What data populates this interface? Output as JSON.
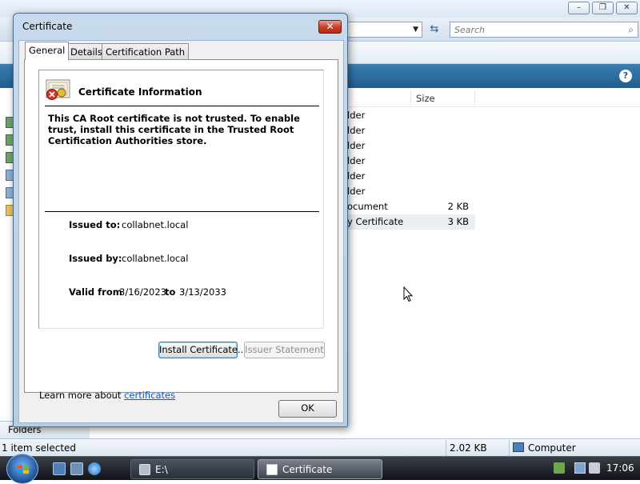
{
  "explorer": {
    "search_placeholder": "Search",
    "column_size": "Size",
    "files": [
      {
        "name": "lder",
        "size": ""
      },
      {
        "name": "lder",
        "size": ""
      },
      {
        "name": "lder",
        "size": ""
      },
      {
        "name": "lder",
        "size": ""
      },
      {
        "name": "lder",
        "size": ""
      },
      {
        "name": "lder",
        "size": ""
      },
      {
        "name": "ocument",
        "size": "2 KB"
      },
      {
        "name": "y Certificate",
        "size": "3 KB"
      }
    ],
    "folders_label": "Folders",
    "status": {
      "selection": "1 item selected",
      "size": "2.02 KB",
      "location": "Computer"
    },
    "help_label": "?"
  },
  "taskbar": {
    "items": [
      {
        "label": "E:\\"
      },
      {
        "label": "Certificate"
      }
    ],
    "clock": "17:06"
  },
  "dialog": {
    "title": "Certificate",
    "close_label": "✕",
    "tabs": [
      {
        "label": "General",
        "active": true
      },
      {
        "label": "Details",
        "active": false
      },
      {
        "label": "Certification Path",
        "active": false
      }
    ],
    "heading": "Certificate Information",
    "warning": "This CA Root certificate is not trusted. To enable trust, install this certificate in the Trusted Root Certification Authorities store.",
    "issued_to_label": "Issued to:",
    "issued_to": "collabnet.local",
    "issued_by_label": "Issued by:",
    "issued_by": "collabnet.local",
    "valid_from_label": "Valid from",
    "valid_from": "3/16/2023",
    "valid_to_label": "to",
    "valid_to": "3/13/2033",
    "install_button": "Install Certificate...",
    "issuer_button": "Issuer Statement",
    "learn_prefix": "Learn more about",
    "learn_link": "certificates",
    "ok_button": "OK"
  },
  "colors": {
    "accent": "#1f5d8f",
    "link": "#0b5cc7",
    "close": "#c8412a"
  }
}
